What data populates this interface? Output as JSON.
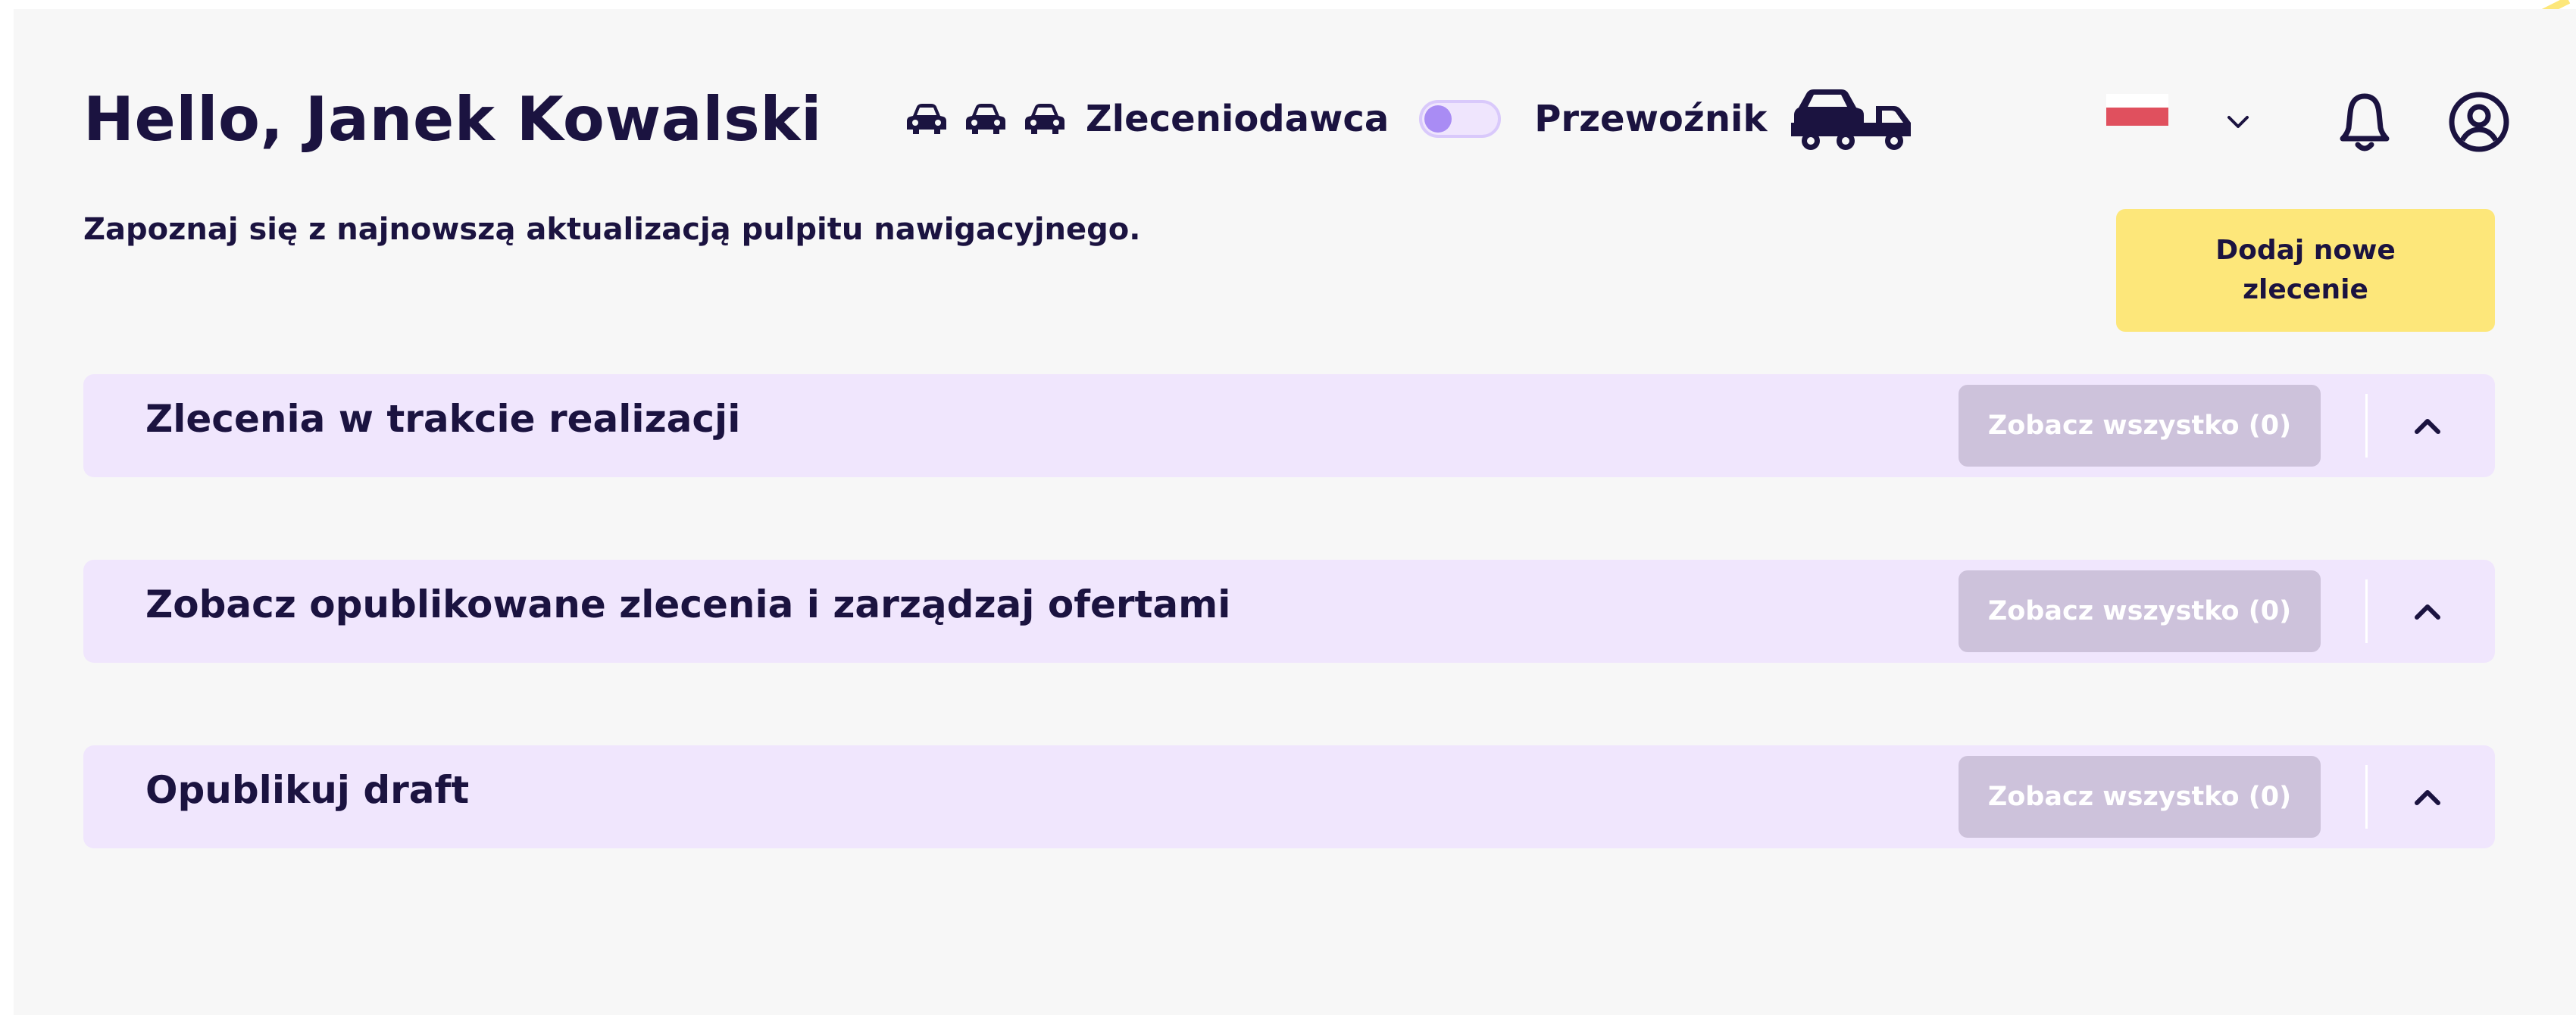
{
  "header": {
    "greeting": "Hello, Janek Kowalski",
    "role_client": "Zleceniodawca",
    "role_carrier": "Przewoźnik",
    "toggle_on": false,
    "icons": [
      "car-icon",
      "car-icon",
      "car-icon",
      "tow-truck-icon",
      "flag-icon",
      "chevron-down-icon",
      "bell-icon",
      "user-circle-icon"
    ]
  },
  "notice": "Zapoznaj się z najnowszą aktualizacją pulpitu nawigacyjnego.",
  "add_button": "Dodaj nowe zlecenie",
  "sections": [
    {
      "title": "Zlecenia w trakcie realizacji",
      "button": "Zobacz wszystko (0)"
    },
    {
      "title": "Zobacz opublikowane zlecenia i zarządzaj ofertami",
      "button": "Zobacz wszystko (0)"
    },
    {
      "title": "Opublikuj draft",
      "button": "Zobacz wszystko (0)"
    }
  ],
  "colors": {
    "text": "#1b1340",
    "panel_bg": "#f7f7f7",
    "section_bg": "#f0e6fd",
    "primary_button": "#fde77a",
    "disabled_button": "#cdc2db",
    "toggle_knob": "#a98cf4",
    "flag_red": "#e0505e"
  }
}
